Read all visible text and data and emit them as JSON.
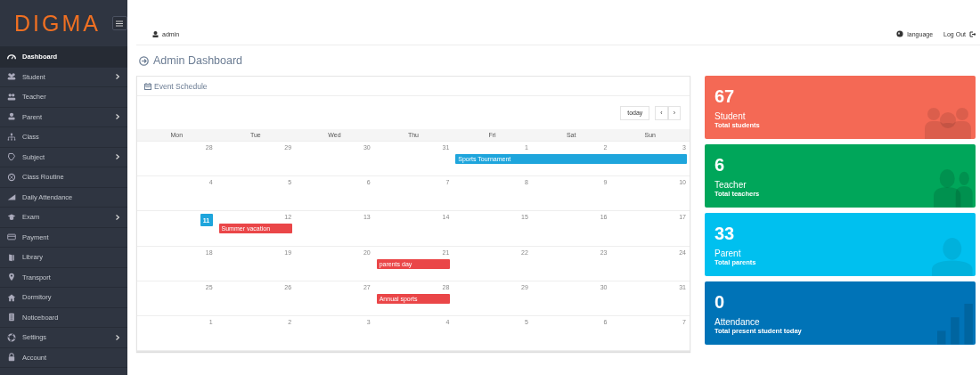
{
  "logo": "DIGMA",
  "sidebar": {
    "items": [
      {
        "label": "Dashboard",
        "selected": true,
        "expandable": false
      },
      {
        "label": "Student",
        "selected": false,
        "expandable": true
      },
      {
        "label": "Teacher",
        "selected": false,
        "expandable": false
      },
      {
        "label": "Parent",
        "selected": false,
        "expandable": true
      },
      {
        "label": "Class",
        "selected": false,
        "expandable": false
      },
      {
        "label": "Subject",
        "selected": false,
        "expandable": true
      },
      {
        "label": "Class Routine",
        "selected": false,
        "expandable": false
      },
      {
        "label": "Daily Attendance",
        "selected": false,
        "expandable": false
      },
      {
        "label": "Exam",
        "selected": false,
        "expandable": true
      },
      {
        "label": "Payment",
        "selected": false,
        "expandable": false
      },
      {
        "label": "Library",
        "selected": false,
        "expandable": false
      },
      {
        "label": "Transport",
        "selected": false,
        "expandable": false
      },
      {
        "label": "Dormitory",
        "selected": false,
        "expandable": false
      },
      {
        "label": "Noticeboard",
        "selected": false,
        "expandable": false
      },
      {
        "label": "Settings",
        "selected": false,
        "expandable": true
      },
      {
        "label": "Account",
        "selected": false,
        "expandable": false
      }
    ]
  },
  "topbar": {
    "user": "admin",
    "language": "language",
    "logout": "Log Out"
  },
  "page_title": "Admin Dashboard",
  "calendar": {
    "title": "Event Schedule",
    "today_button": "today",
    "prev": "‹",
    "next": "›",
    "weekdays": [
      "Mon",
      "Tue",
      "Wed",
      "Thu",
      "Fri",
      "Sat",
      "Sun"
    ],
    "weeks": [
      {
        "days": [
          {
            "n": "28",
            "today": false
          },
          {
            "n": "29",
            "today": false
          },
          {
            "n": "30",
            "today": false
          },
          {
            "n": "31",
            "today": false
          },
          {
            "n": "1",
            "today": false,
            "events": [
              {
                "label": "Sports Tournament",
                "color": "#1ea5dc"
              }
            ]
          },
          {
            "n": "2",
            "today": false,
            "event_continues": true
          },
          {
            "n": "3",
            "today": false,
            "event_continues": true
          }
        ]
      },
      {
        "days": [
          {
            "n": "4",
            "today": false
          },
          {
            "n": "5",
            "today": false
          },
          {
            "n": "6",
            "today": false
          },
          {
            "n": "7",
            "today": false
          },
          {
            "n": "8",
            "today": false
          },
          {
            "n": "9",
            "today": false
          },
          {
            "n": "10",
            "today": false
          }
        ]
      },
      {
        "days": [
          {
            "n": "11",
            "today": true
          },
          {
            "n": "12",
            "today": false,
            "events": [
              {
                "label": "Summer vacation",
                "color": "#ea4648"
              }
            ]
          },
          {
            "n": "13",
            "today": false
          },
          {
            "n": "14",
            "today": false
          },
          {
            "n": "15",
            "today": false
          },
          {
            "n": "16",
            "today": false
          },
          {
            "n": "17",
            "today": false
          }
        ]
      },
      {
        "days": [
          {
            "n": "18",
            "today": false
          },
          {
            "n": "19",
            "today": false
          },
          {
            "n": "20",
            "today": false
          },
          {
            "n": "21",
            "today": false,
            "events": [
              {
                "label": "parents day",
                "color": "#ea4648"
              }
            ]
          },
          {
            "n": "22",
            "today": false
          },
          {
            "n": "23",
            "today": false
          },
          {
            "n": "24",
            "today": false
          }
        ]
      },
      {
        "days": [
          {
            "n": "25",
            "today": false
          },
          {
            "n": "26",
            "today": false
          },
          {
            "n": "27",
            "today": false
          },
          {
            "n": "28",
            "today": false,
            "events": [
              {
                "label": "Annual sports",
                "color": "#ea4648"
              }
            ]
          },
          {
            "n": "29",
            "today": false
          },
          {
            "n": "30",
            "today": false
          },
          {
            "n": "31",
            "today": false
          }
        ]
      },
      {
        "days": [
          {
            "n": "1",
            "today": false
          },
          {
            "n": "2",
            "today": false
          },
          {
            "n": "3",
            "today": false
          },
          {
            "n": "4",
            "today": false
          },
          {
            "n": "5",
            "today": false
          },
          {
            "n": "6",
            "today": false
          },
          {
            "n": "7",
            "today": false
          }
        ]
      }
    ]
  },
  "stats": [
    {
      "kind": "group",
      "value": "67",
      "title": "Student",
      "subtitle": "Total students",
      "color": "#f46955"
    },
    {
      "kind": "pair",
      "value": "6",
      "title": "Teacher",
      "subtitle": "Total teachers",
      "color": "#00a65a"
    },
    {
      "kind": "person",
      "value": "33",
      "title": "Parent",
      "subtitle": "Total parents",
      "color": "#00c0ef"
    },
    {
      "kind": "bars",
      "value": "0",
      "title": "Attendance",
      "subtitle": "Total present student today",
      "color": "#0073b7"
    }
  ]
}
